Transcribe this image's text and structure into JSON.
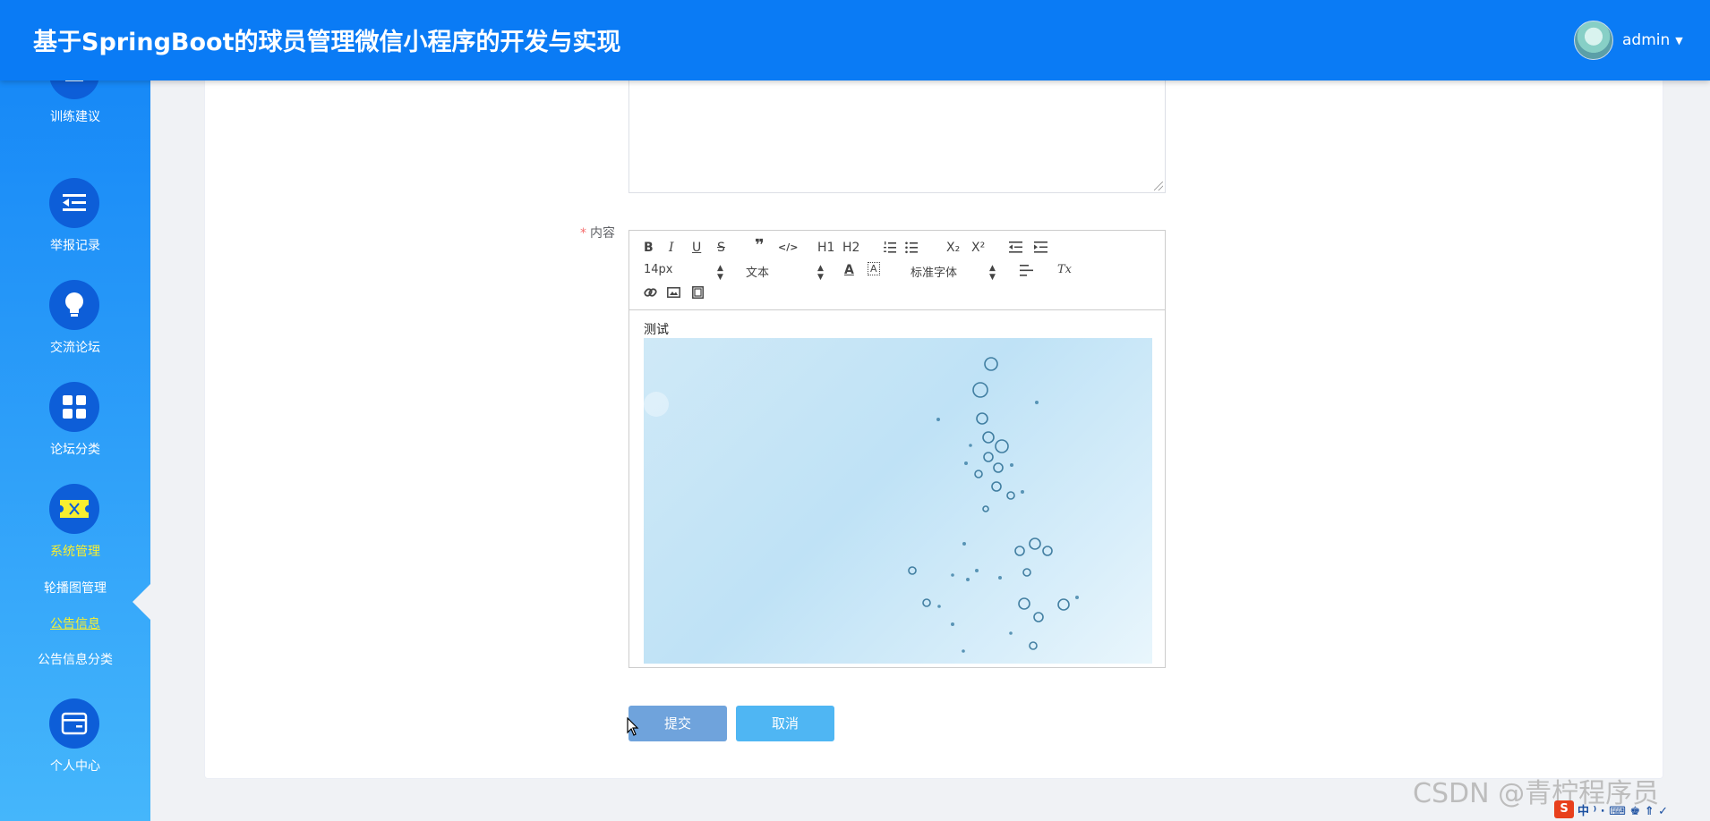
{
  "header": {
    "title": "基于SpringBoot的球员管理微信小程序的开发与实现",
    "username": "admin"
  },
  "sidebar": {
    "items": [
      {
        "label": "训练建议",
        "icon": "close-icon"
      },
      {
        "label": "举报记录",
        "icon": "list-indent-icon"
      },
      {
        "label": "交流论坛",
        "icon": "lightbulb-icon"
      },
      {
        "label": "论坛分类",
        "icon": "grid-icon"
      },
      {
        "label": "系统管理",
        "icon": "ticket-icon"
      },
      {
        "label": "个人中心",
        "icon": "wallet-icon"
      }
    ],
    "subitems": [
      "轮播图管理",
      "公告信息",
      "公告信息分类"
    ],
    "active_item": "系统管理",
    "active_subitem": "公告信息"
  },
  "form": {
    "required_mark": "*",
    "content_label": "内容",
    "font_size": "14px",
    "text_style": "文本",
    "font_family": "标准字体",
    "body_text": "测试",
    "submit": "提交",
    "cancel": "取消"
  },
  "toolbar": {
    "bold": "B",
    "italic": "I",
    "underline": "U",
    "strike": "S",
    "h1": "H1",
    "h2": "H2",
    "sub": "X₂",
    "sup": "X²",
    "clear": "Tx"
  },
  "watermark": "CSDN @青柠程序员",
  "tray": {
    "s_icon": "S",
    "text": "中 ⁾ ∙ ⌨ ♚ ⇑ ✓"
  },
  "colors": {
    "header_bg": "#0a7bf5",
    "sidebar_top": "#1789f7",
    "sidebar_bottom": "#45b6fb",
    "icon_circle": "#0d5ed8",
    "active_text": "#f8ef2f",
    "submit_bg": "#6fa3dc",
    "cancel_bg": "#4fb6f3"
  }
}
